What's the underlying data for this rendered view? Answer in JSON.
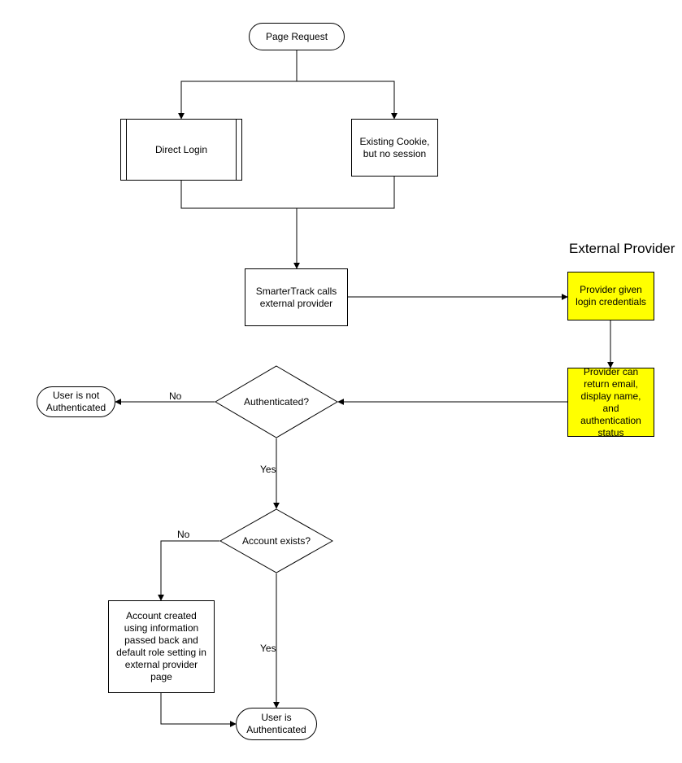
{
  "nodes": {
    "pageRequest": "Page Request",
    "directLogin": "Direct Login",
    "existingCookie": "Existing Cookie, but no session",
    "stCalls": "SmarterTrack calls external provider",
    "providerCreds": "Provider given login credentials",
    "providerReturn": "Provider can return email, display name, and authentication status",
    "authenticatedQ": "Authenticated?",
    "userNotAuth": "User is not Authenticated",
    "accountExistsQ": "Account exists?",
    "accountCreated": "Account created using information passed back and default role setting in external provider page",
    "userIsAuth": "User is Authenticated"
  },
  "labels": {
    "externalProviderHeading": "External Provider",
    "no1": "No",
    "yes1": "Yes",
    "no2": "No",
    "yes2": "Yes"
  },
  "colors": {
    "highlight": "#ffff00",
    "line": "#000000",
    "bg": "#ffffff"
  }
}
